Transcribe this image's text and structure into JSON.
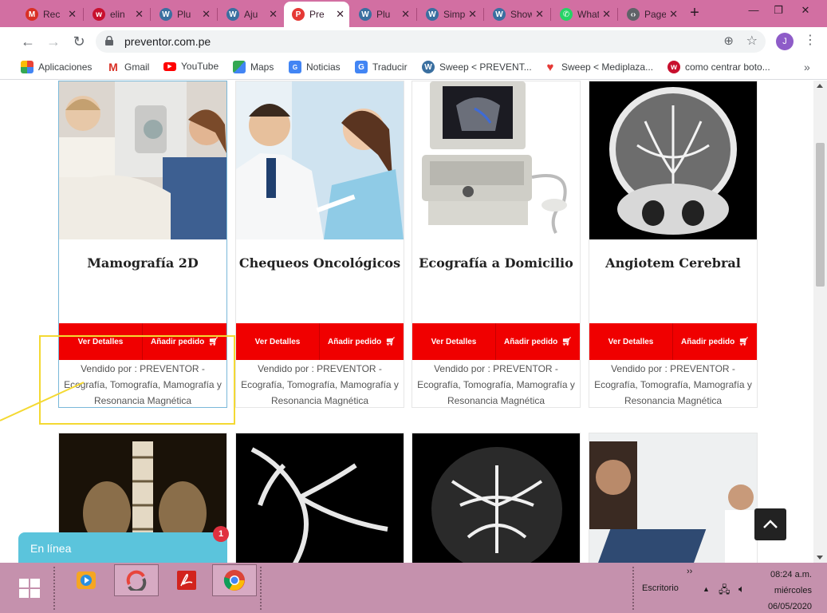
{
  "browser": {
    "tabs": [
      {
        "label": "Rec",
        "icon": "gmail-icon",
        "color": "#d93025",
        "glyph": "M"
      },
      {
        "label": "elin",
        "icon": "red-w-icon",
        "color": "#c8102e",
        "glyph": "w"
      },
      {
        "label": "Plu",
        "icon": "wordpress-icon",
        "color": "#3a6fa0",
        "glyph": "W"
      },
      {
        "label": "Aju",
        "icon": "wordpress-icon",
        "color": "#3a6fa0",
        "glyph": "W"
      },
      {
        "label": "Pre",
        "icon": "preventor-icon",
        "color": "#e53935",
        "glyph": "P",
        "active": true
      },
      {
        "label": "Plu",
        "icon": "wordpress-icon",
        "color": "#3a6fa0",
        "glyph": "W"
      },
      {
        "label": "Simple",
        "icon": "wordpress-icon",
        "color": "#3a6fa0",
        "glyph": "W"
      },
      {
        "label": "Showca",
        "icon": "wordpress-icon",
        "color": "#3a6fa0",
        "glyph": "W"
      },
      {
        "label": "WhatsA",
        "icon": "whatsapp-icon",
        "color": "#25d366",
        "glyph": "✆"
      },
      {
        "label": "PageSp",
        "icon": "pagespeed-icon",
        "color": "#5f6368",
        "glyph": "‹›"
      }
    ],
    "url": "preventor.com.pe",
    "profile_initial": "J",
    "bookmarks": [
      {
        "label": "Aplicaciones",
        "icon": "apps-grid-icon",
        "color": "#e8453c"
      },
      {
        "label": "Gmail",
        "icon": "gmail-icon",
        "color": "#d93025"
      },
      {
        "label": "YouTube",
        "icon": "youtube-icon",
        "color": "#ff0000"
      },
      {
        "label": "Maps",
        "icon": "maps-icon",
        "color": "#34a853"
      },
      {
        "label": "Noticias",
        "icon": "news-icon",
        "color": "#4285f4"
      },
      {
        "label": "Traducir",
        "icon": "translate-icon",
        "color": "#4285f4"
      },
      {
        "label": "Sweep < PREVENT...",
        "icon": "wordpress-icon",
        "color": "#3a6fa0"
      },
      {
        "label": "Sweep < Mediplaza...",
        "icon": "heart-icon",
        "color": "#e53935"
      },
      {
        "label": "como centrar boto...",
        "icon": "red-w-icon",
        "color": "#c8102e"
      }
    ]
  },
  "products": [
    {
      "title": "Mamografía 2D",
      "details": "Ver Detalles",
      "add": "Añadir pedido",
      "vendor": "Vendido por : PREVENTOR - Ecografía, Tomografía, Mamografía y Resonancia Magnética"
    },
    {
      "title": "Chequeos Oncológicos",
      "details": "Ver Detalles",
      "add": "Añadir pedido",
      "vendor": "Vendido por : PREVENTOR - Ecografía, Tomografía, Mamografía y Resonancia Magnética"
    },
    {
      "title": "Ecografía a Domicilio",
      "details": "Ver Detalles",
      "add": "Añadir pedido",
      "vendor": "Vendido por : PREVENTOR - Ecografía, Tomografía, Mamografía y Resonancia Magnética"
    },
    {
      "title": "Angiotem Cerebral",
      "details": "Ver Detalles",
      "add": "Añadir pedido",
      "vendor": "Vendido por : PREVENTOR - Ecografía, Tomografía, Mamografía y Resonancia Magnética"
    }
  ],
  "chat": {
    "label": "En línea",
    "badge": "1"
  },
  "taskbar": {
    "desktop": "Escritorio",
    "time": "08:24 a.m.",
    "day": "miércoles",
    "date": "06/05/2020"
  },
  "colors": {
    "accent_red": "#f00000",
    "chrome_pink": "#d26fa2",
    "annotation_yellow": "#f4d932"
  }
}
